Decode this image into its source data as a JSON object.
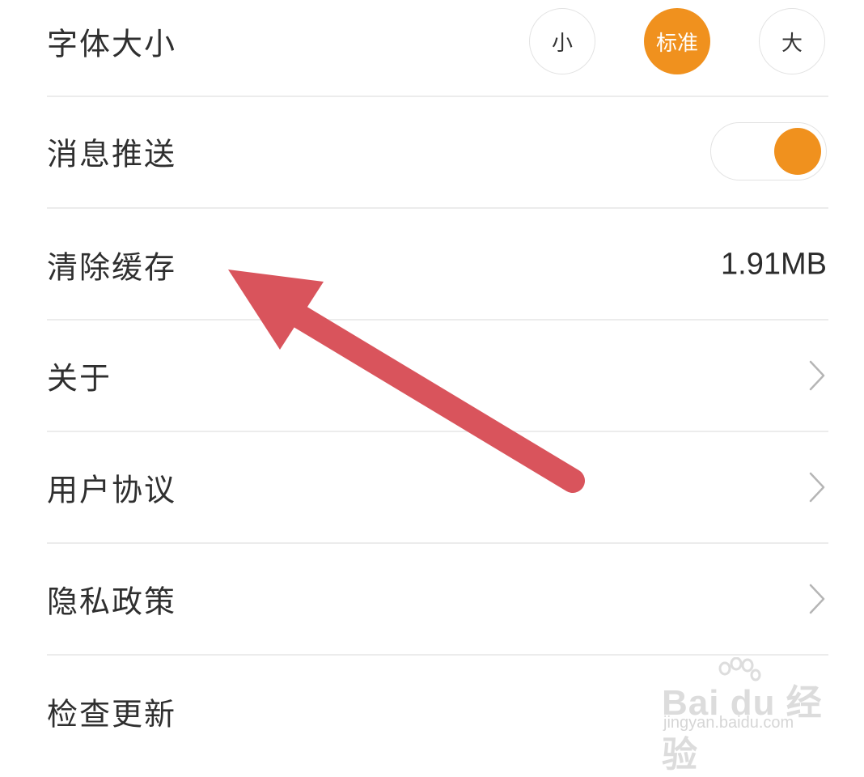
{
  "colors": {
    "accent": "#f0911e",
    "arrow": "#d9545c"
  },
  "settings": {
    "font_size": {
      "label": "字体大小",
      "options": [
        "小",
        "标准",
        "大"
      ],
      "selected": "标准"
    },
    "push": {
      "label": "消息推送",
      "enabled": true
    },
    "cache": {
      "label": "清除缓存",
      "value": "1.91MB"
    },
    "about": {
      "label": "关于",
      "icon": "chevron-right-icon"
    },
    "agreement": {
      "label": "用户协议",
      "icon": "chevron-right-icon"
    },
    "privacy": {
      "label": "隐私政策",
      "icon": "chevron-right-icon"
    },
    "update": {
      "label": "检查更新"
    }
  },
  "annotation": {
    "icon": "arrow-pointer-icon"
  },
  "watermark": {
    "brand": "Bai du 经验",
    "site": "jingyan.baidu.com"
  }
}
